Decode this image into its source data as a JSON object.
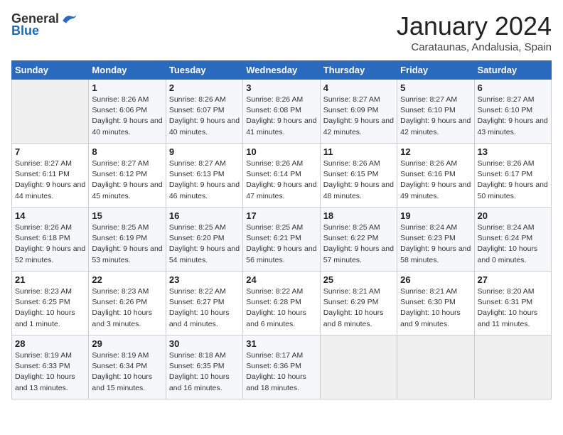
{
  "logo": {
    "text_general": "General",
    "text_blue": "Blue"
  },
  "header": {
    "month_title": "January 2024",
    "location": "Carataunas, Andalusia, Spain"
  },
  "days_of_week": [
    "Sunday",
    "Monday",
    "Tuesday",
    "Wednesday",
    "Thursday",
    "Friday",
    "Saturday"
  ],
  "weeks": [
    [
      {
        "day": "",
        "sunrise": "",
        "sunset": "",
        "daylight": ""
      },
      {
        "day": "1",
        "sunrise": "Sunrise: 8:26 AM",
        "sunset": "Sunset: 6:06 PM",
        "daylight": "Daylight: 9 hours and 40 minutes."
      },
      {
        "day": "2",
        "sunrise": "Sunrise: 8:26 AM",
        "sunset": "Sunset: 6:07 PM",
        "daylight": "Daylight: 9 hours and 40 minutes."
      },
      {
        "day": "3",
        "sunrise": "Sunrise: 8:26 AM",
        "sunset": "Sunset: 6:08 PM",
        "daylight": "Daylight: 9 hours and 41 minutes."
      },
      {
        "day": "4",
        "sunrise": "Sunrise: 8:27 AM",
        "sunset": "Sunset: 6:09 PM",
        "daylight": "Daylight: 9 hours and 42 minutes."
      },
      {
        "day": "5",
        "sunrise": "Sunrise: 8:27 AM",
        "sunset": "Sunset: 6:10 PM",
        "daylight": "Daylight: 9 hours and 42 minutes."
      },
      {
        "day": "6",
        "sunrise": "Sunrise: 8:27 AM",
        "sunset": "Sunset: 6:10 PM",
        "daylight": "Daylight: 9 hours and 43 minutes."
      }
    ],
    [
      {
        "day": "7",
        "sunrise": "Sunrise: 8:27 AM",
        "sunset": "Sunset: 6:11 PM",
        "daylight": "Daylight: 9 hours and 44 minutes."
      },
      {
        "day": "8",
        "sunrise": "Sunrise: 8:27 AM",
        "sunset": "Sunset: 6:12 PM",
        "daylight": "Daylight: 9 hours and 45 minutes."
      },
      {
        "day": "9",
        "sunrise": "Sunrise: 8:27 AM",
        "sunset": "Sunset: 6:13 PM",
        "daylight": "Daylight: 9 hours and 46 minutes."
      },
      {
        "day": "10",
        "sunrise": "Sunrise: 8:26 AM",
        "sunset": "Sunset: 6:14 PM",
        "daylight": "Daylight: 9 hours and 47 minutes."
      },
      {
        "day": "11",
        "sunrise": "Sunrise: 8:26 AM",
        "sunset": "Sunset: 6:15 PM",
        "daylight": "Daylight: 9 hours and 48 minutes."
      },
      {
        "day": "12",
        "sunrise": "Sunrise: 8:26 AM",
        "sunset": "Sunset: 6:16 PM",
        "daylight": "Daylight: 9 hours and 49 minutes."
      },
      {
        "day": "13",
        "sunrise": "Sunrise: 8:26 AM",
        "sunset": "Sunset: 6:17 PM",
        "daylight": "Daylight: 9 hours and 50 minutes."
      }
    ],
    [
      {
        "day": "14",
        "sunrise": "Sunrise: 8:26 AM",
        "sunset": "Sunset: 6:18 PM",
        "daylight": "Daylight: 9 hours and 52 minutes."
      },
      {
        "day": "15",
        "sunrise": "Sunrise: 8:25 AM",
        "sunset": "Sunset: 6:19 PM",
        "daylight": "Daylight: 9 hours and 53 minutes."
      },
      {
        "day": "16",
        "sunrise": "Sunrise: 8:25 AM",
        "sunset": "Sunset: 6:20 PM",
        "daylight": "Daylight: 9 hours and 54 minutes."
      },
      {
        "day": "17",
        "sunrise": "Sunrise: 8:25 AM",
        "sunset": "Sunset: 6:21 PM",
        "daylight": "Daylight: 9 hours and 56 minutes."
      },
      {
        "day": "18",
        "sunrise": "Sunrise: 8:25 AM",
        "sunset": "Sunset: 6:22 PM",
        "daylight": "Daylight: 9 hours and 57 minutes."
      },
      {
        "day": "19",
        "sunrise": "Sunrise: 8:24 AM",
        "sunset": "Sunset: 6:23 PM",
        "daylight": "Daylight: 9 hours and 58 minutes."
      },
      {
        "day": "20",
        "sunrise": "Sunrise: 8:24 AM",
        "sunset": "Sunset: 6:24 PM",
        "daylight": "Daylight: 10 hours and 0 minutes."
      }
    ],
    [
      {
        "day": "21",
        "sunrise": "Sunrise: 8:23 AM",
        "sunset": "Sunset: 6:25 PM",
        "daylight": "Daylight: 10 hours and 1 minute."
      },
      {
        "day": "22",
        "sunrise": "Sunrise: 8:23 AM",
        "sunset": "Sunset: 6:26 PM",
        "daylight": "Daylight: 10 hours and 3 minutes."
      },
      {
        "day": "23",
        "sunrise": "Sunrise: 8:22 AM",
        "sunset": "Sunset: 6:27 PM",
        "daylight": "Daylight: 10 hours and 4 minutes."
      },
      {
        "day": "24",
        "sunrise": "Sunrise: 8:22 AM",
        "sunset": "Sunset: 6:28 PM",
        "daylight": "Daylight: 10 hours and 6 minutes."
      },
      {
        "day": "25",
        "sunrise": "Sunrise: 8:21 AM",
        "sunset": "Sunset: 6:29 PM",
        "daylight": "Daylight: 10 hours and 8 minutes."
      },
      {
        "day": "26",
        "sunrise": "Sunrise: 8:21 AM",
        "sunset": "Sunset: 6:30 PM",
        "daylight": "Daylight: 10 hours and 9 minutes."
      },
      {
        "day": "27",
        "sunrise": "Sunrise: 8:20 AM",
        "sunset": "Sunset: 6:31 PM",
        "daylight": "Daylight: 10 hours and 11 minutes."
      }
    ],
    [
      {
        "day": "28",
        "sunrise": "Sunrise: 8:19 AM",
        "sunset": "Sunset: 6:33 PM",
        "daylight": "Daylight: 10 hours and 13 minutes."
      },
      {
        "day": "29",
        "sunrise": "Sunrise: 8:19 AM",
        "sunset": "Sunset: 6:34 PM",
        "daylight": "Daylight: 10 hours and 15 minutes."
      },
      {
        "day": "30",
        "sunrise": "Sunrise: 8:18 AM",
        "sunset": "Sunset: 6:35 PM",
        "daylight": "Daylight: 10 hours and 16 minutes."
      },
      {
        "day": "31",
        "sunrise": "Sunrise: 8:17 AM",
        "sunset": "Sunset: 6:36 PM",
        "daylight": "Daylight: 10 hours and 18 minutes."
      },
      {
        "day": "",
        "sunrise": "",
        "sunset": "",
        "daylight": ""
      },
      {
        "day": "",
        "sunrise": "",
        "sunset": "",
        "daylight": ""
      },
      {
        "day": "",
        "sunrise": "",
        "sunset": "",
        "daylight": ""
      }
    ]
  ]
}
